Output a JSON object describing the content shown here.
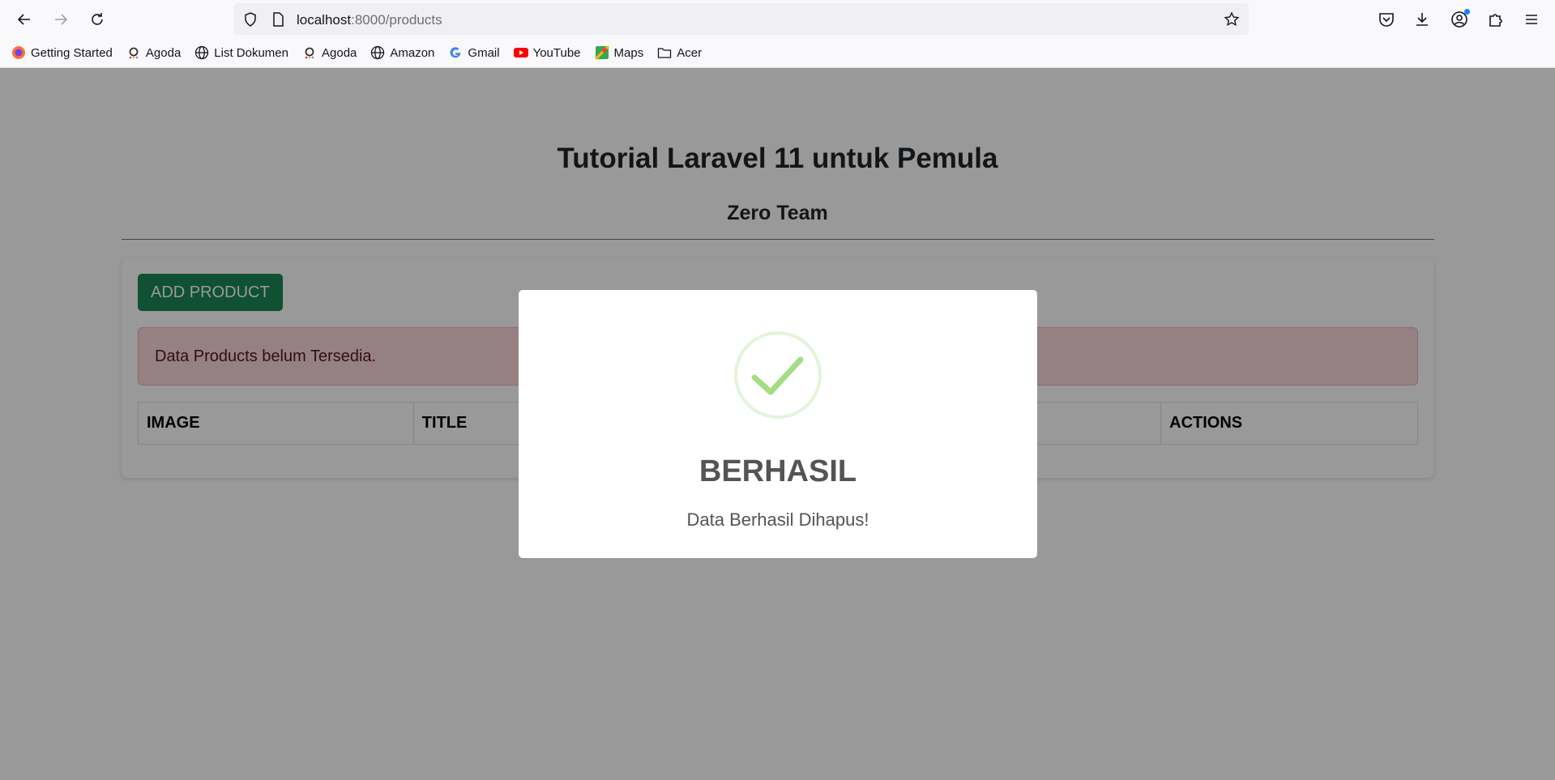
{
  "browser": {
    "url_host": "localhost",
    "url_path": ":8000/products",
    "bookmarks": [
      {
        "label": "Getting Started",
        "icon": "firefox-icon"
      },
      {
        "label": "Agoda",
        "icon": "agoda-icon"
      },
      {
        "label": "List Dokumen",
        "icon": "globe-icon"
      },
      {
        "label": "Agoda",
        "icon": "agoda-icon"
      },
      {
        "label": "Amazon",
        "icon": "globe-icon"
      },
      {
        "label": "Gmail",
        "icon": "google-icon"
      },
      {
        "label": "YouTube",
        "icon": "youtube-icon"
      },
      {
        "label": "Maps",
        "icon": "maps-icon"
      },
      {
        "label": "Acer",
        "icon": "folder-icon"
      }
    ]
  },
  "page": {
    "title": "Tutorial Laravel 11 untuk Pemula",
    "subtitle": "Zero Team",
    "add_button": "ADD PRODUCT",
    "alert": "Data Products belum Tersedia.",
    "table_headers": [
      "IMAGE",
      "TITLE",
      "ACTIONS"
    ]
  },
  "modal": {
    "title": "BERHASIL",
    "text": "Data Berhasil Dihapus!",
    "icon": "success-check-icon"
  },
  "colors": {
    "primary_button": "#198754",
    "alert_bg": "#f8d7da",
    "success_icon": "#a5dc86",
    "overlay": "rgba(0,0,0,0.4)"
  }
}
